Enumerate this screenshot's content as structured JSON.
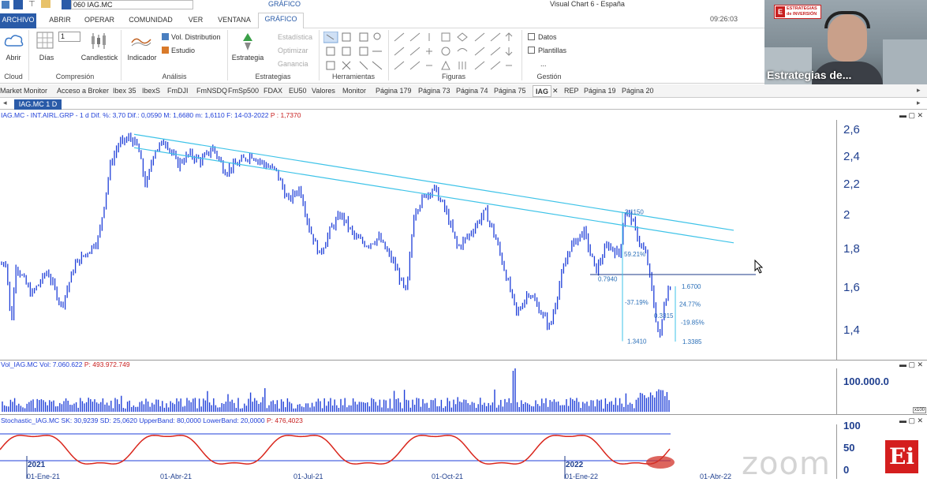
{
  "window": {
    "title": "Visual Chart 6 - España",
    "ribbon_context": "GRÁFICO",
    "ticker_combo": "060 IAG.MC",
    "clock": "09:26:03"
  },
  "menu_tabs": [
    "ARCHIVO",
    "ABRIR",
    "OPERAR",
    "COMUNIDAD",
    "VER",
    "VENTANA",
    "GRÁFICO"
  ],
  "ribbon": {
    "cloud": {
      "label": "Abrir",
      "group": "Cloud"
    },
    "compresion": {
      "days_value": "1",
      "days_label": "Días",
      "candle_label": "Candlestick",
      "group": "Compresión"
    },
    "analisis": {
      "indicator_label": "Indicador",
      "vol_dist": "Vol. Distribution",
      "estudio": "Estudio",
      "group": "Análisis"
    },
    "estrategias": {
      "estrategia_label": "Estrategia",
      "estadistica": "Estadística",
      "optimizar": "Optimizar",
      "ganancia": "Ganancia",
      "group": "Estrategias"
    },
    "herramientas": {
      "group": "Herramientas"
    },
    "figuras": {
      "group": "Figuras"
    },
    "gestion": {
      "datos": "Datos",
      "plantillas": "Plantillas",
      "more": "...",
      "group": "Gestión"
    }
  },
  "ticker_tabs": [
    "Market Monitor",
    "Acceso a Broker",
    "Ibex 35",
    "IbexS",
    "FmDJI",
    "FmNSDQ",
    "FmSp500",
    "FDAX",
    "EU50",
    "Valores",
    "Monitor",
    "Página 179",
    "Página 73",
    "Página 74",
    "Página 75",
    "IAG",
    "REP",
    "Página 19",
    "Página 20"
  ],
  "active_ticker_tab": "IAG",
  "document_tab": "IAG.MC 1 D",
  "main_panel": {
    "header_left": "IAG.MC - INT.AIRL.GRP - 1 d",
    "dif_pct": "Dif. %: 3,70",
    "dif": "Dif.: 0,0590",
    "m": "M: 1,6680",
    "m2": "m: 1,6110",
    "f": "F: 14-03-2022",
    "p": "P : 1,7370",
    "y_ticks": [
      "2,6",
      "2,4",
      "2,2",
      "2",
      "1,8",
      "1,6",
      "1,4"
    ],
    "annotations": {
      "high": "2.1150",
      "pct_top": "59.21%",
      "range_left": "0.7940",
      "neg37": "-37.19%",
      "low_left": "1.3410",
      "mid_low": "0.3315",
      "right_top": "1.6700",
      "pct_right": "24.77%",
      "neg19": "-19.85%",
      "low_right": "1.3385"
    }
  },
  "volume_panel": {
    "header_left": "Vol_IAG.MC",
    "vol": "Vol: 7.060.622",
    "p": "P: 493.972.749",
    "y_tick": "100.000.0",
    "corner": "x100"
  },
  "stoch_panel": {
    "header_left": "Stochastic_IAG.MC",
    "sk": "SK: 30,9239",
    "sd": "SD: 25,0620",
    "upper": "UpperBand: 80,0000",
    "lower": "LowerBand: 20,0000",
    "p": "P: 476,4023",
    "y_ticks": [
      "100",
      "50",
      "0"
    ]
  },
  "x_axis": {
    "years": [
      "2021",
      "2022"
    ],
    "dates": [
      "01-Ene-21",
      "01-Abr-21",
      "01-Jul-21",
      "01-Oct-21",
      "01-Ene-22",
      "01-Abr-22"
    ]
  },
  "webcam": {
    "caption": "Estrategias de...",
    "badge": "ESTRATEGIAS de INVERSIÓN",
    "logo": "Ei"
  },
  "watermark": "zoom",
  "colors": {
    "accent": "#2a5ba8",
    "candles": "#1f3fd8",
    "trendlines": "#3ec3e8",
    "stoch_k": "#d9261c",
    "stoch_band": "#1f3fd8"
  }
}
